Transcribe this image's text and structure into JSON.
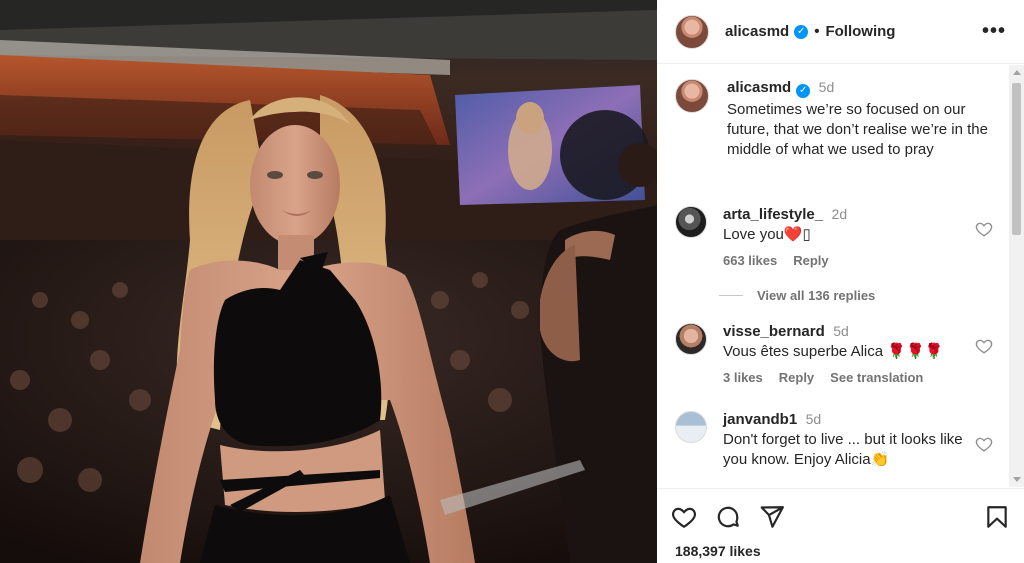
{
  "post": {
    "username": "alicasmd",
    "follow_status": "Following",
    "separator": "•",
    "more_icon": "more-horizontal-icon",
    "caption": {
      "username": "alicasmd",
      "age": "5d",
      "text": "Sometimes we’re so focused on our future, that we don’t realise we’re in the middle of what we used to pray"
    },
    "comments": [
      {
        "username": "arta_lifestyle_",
        "age": "2d",
        "text": "Love you❤️▯",
        "likes": "663 likes",
        "reply": "Reply",
        "view_replies": "View all 136 replies"
      },
      {
        "username": "visse_bernard",
        "age": "5d",
        "text": "Vous êtes superbe Alica 🌹🌹🌹",
        "likes": "3 likes",
        "reply": "Reply",
        "translation": "See translation"
      },
      {
        "username": "janvandb1",
        "age": "5d",
        "text": "Don't forget to live ... but it looks like you know. Enjoy Alicia👏"
      }
    ],
    "like_count": "188,397 likes"
  },
  "colors": {
    "verified": "#0095f6",
    "text_primary": "#262626",
    "text_secondary": "#737373"
  }
}
